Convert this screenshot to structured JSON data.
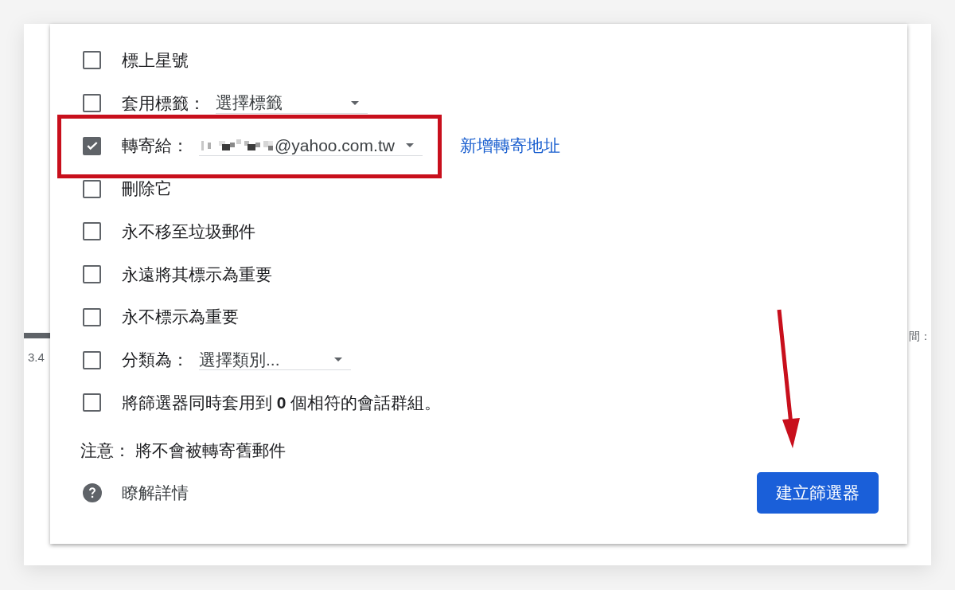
{
  "background": {
    "left_fragment_text": "3.4",
    "right_fragment_text": "間："
  },
  "dialog": {
    "actions": [
      {
        "kind": "checkbox",
        "label": "標上星號",
        "checked": false,
        "highlighted": false
      },
      {
        "kind": "select",
        "label": "套用標籤：",
        "value": "選擇標籤",
        "redacted_prefix": false,
        "checked": false,
        "highlighted": false
      },
      {
        "kind": "select",
        "label": "轉寄給：",
        "value": "@yahoo.com.tw",
        "redacted_prefix": true,
        "checked": true,
        "highlighted": true,
        "link": "新增轉寄地址"
      },
      {
        "kind": "checkbox",
        "label": "刪除它",
        "checked": false,
        "highlighted": false
      },
      {
        "kind": "checkbox",
        "label": "永不移至垃圾郵件",
        "checked": false,
        "highlighted": false
      },
      {
        "kind": "checkbox",
        "label": "永遠將其標示為重要",
        "checked": false,
        "highlighted": false
      },
      {
        "kind": "checkbox",
        "label": "永不標示為重要",
        "checked": false,
        "highlighted": false
      },
      {
        "kind": "select",
        "label": "分類為：",
        "value": "選擇類別...",
        "redacted_prefix": false,
        "checked": false,
        "highlighted": false
      },
      {
        "kind": "checkbox",
        "label": "將篩選器同時套用到 **0** 個相符的會話群組。",
        "checked": false,
        "highlighted": false
      }
    ],
    "note": "注意： 將不會被轉寄舊郵件",
    "help_link": "瞭解詳情",
    "create_button": {
      "label": "建立篩選器",
      "arrow_annotation": true
    }
  }
}
